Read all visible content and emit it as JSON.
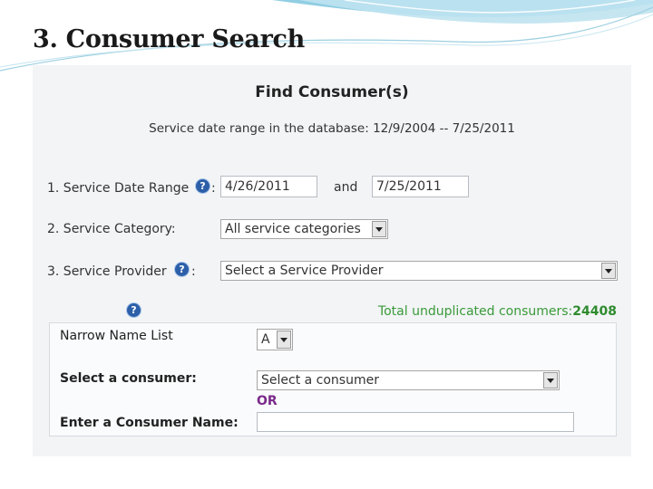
{
  "slide": {
    "title": "3. Consumer Search"
  },
  "form": {
    "heading": "Find Consumer(s)",
    "range_info": "Service date range in the database: 12/9/2004 -- 7/25/2011",
    "date_range": {
      "label": "1. Service Date Range",
      "colon": ":",
      "start_value": "4/26/2011",
      "and_label": "and",
      "end_value": "7/25/2011"
    },
    "service_category": {
      "label": "2. Service Category:",
      "selected": "All service categories"
    },
    "service_provider": {
      "label": "3. Service Provider",
      "colon": ":",
      "selected": "Select a Service Provider"
    },
    "total": {
      "label": "Total unduplicated consumers:",
      "count": "24408"
    },
    "help_glyph": "?",
    "narrow": {
      "label": "Narrow Name List",
      "selected": "A",
      "select_consumer_label": "Select a consumer:",
      "consumer_selected": "Select a consumer",
      "or_label": "OR",
      "enter_name_label": "Enter a Consumer Name:",
      "name_value": ""
    }
  },
  "colors": {
    "help_icon": "#2c5fa8",
    "total_text": "#3a9a3a",
    "or_text": "#7a2a8a",
    "panel_bg": "#f2f4f6"
  },
  "icons": [
    "help-icon",
    "dropdown-arrow-icon"
  ]
}
